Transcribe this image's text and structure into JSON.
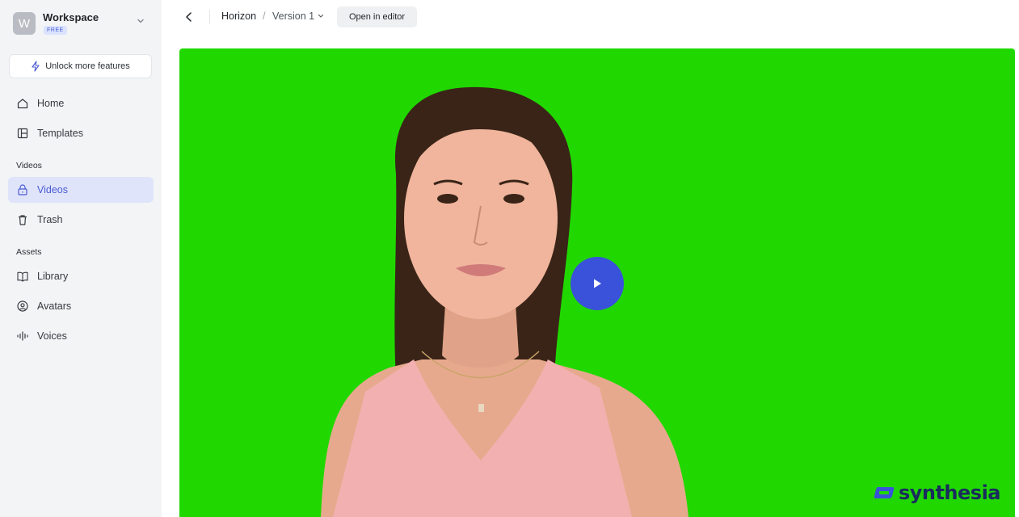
{
  "workspace": {
    "initial": "W",
    "name": "Workspace",
    "plan_badge": "FREE"
  },
  "unlock": {
    "label": "Unlock more features"
  },
  "nav": {
    "home": "Home",
    "templates": "Templates",
    "videos_section": "Videos",
    "videos": "Videos",
    "trash": "Trash",
    "assets_section": "Assets",
    "library": "Library",
    "avatars": "Avatars",
    "voices": "Voices"
  },
  "topbar": {
    "project": "Horizon",
    "separator": "/",
    "version": "Version 1",
    "open_editor": "Open in editor"
  },
  "video": {
    "background_color": "#20d800",
    "play_button_color": "#3a52d9"
  },
  "logo": {
    "text": "synthesia"
  },
  "colors": {
    "accent": "#4a5bd4",
    "active_bg": "#dfe4fb",
    "sidebar_bg": "#f3f4f6"
  }
}
